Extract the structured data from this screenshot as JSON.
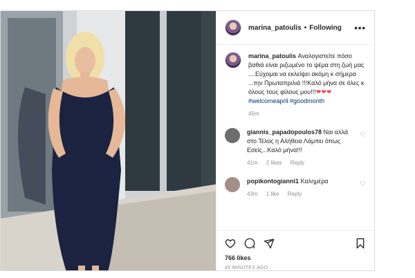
{
  "header": {
    "username": "marina_patoulis",
    "separator": "•",
    "follow_label": "Following",
    "more_label": "•••"
  },
  "caption": {
    "username": "marina_patoulis",
    "text": "Αναλογιστείτε πόσο βαθιά είναι ριζωμένο το ψέμα στη ζωή μας ....Εύχομαι να εκλείψει ακόμη κ σήμερα ...την Πρωταπριλιά !!!Καλό μήνα σε όλες κ όλους τους φίλους μου!!!",
    "hearts": "❤❤❤",
    "tag1": "#welcomeapril",
    "tag2": "#goodmonth",
    "time": "45m"
  },
  "comments": [
    {
      "username": "giannis_papadopoulos78",
      "text": "Ναι αλλά στο Τέλος η Αλήθεια Λάμπει όπως Εσείς...Καλό μήνα!!!",
      "time": "41m",
      "likes": "2 likes",
      "reply": "Reply"
    },
    {
      "username": "popikontogianni1",
      "text": "Καλημέρα",
      "time": "43m",
      "likes": "1 like",
      "reply": "Reply"
    }
  ],
  "actions": {
    "likes": "766 likes",
    "timestamp": "45 MINUTES AGO"
  },
  "colors": {
    "border": "#dbdbdb",
    "text": "#262626",
    "muted": "#8e8e8e",
    "link": "#00376b",
    "heart": "#ed4956"
  }
}
